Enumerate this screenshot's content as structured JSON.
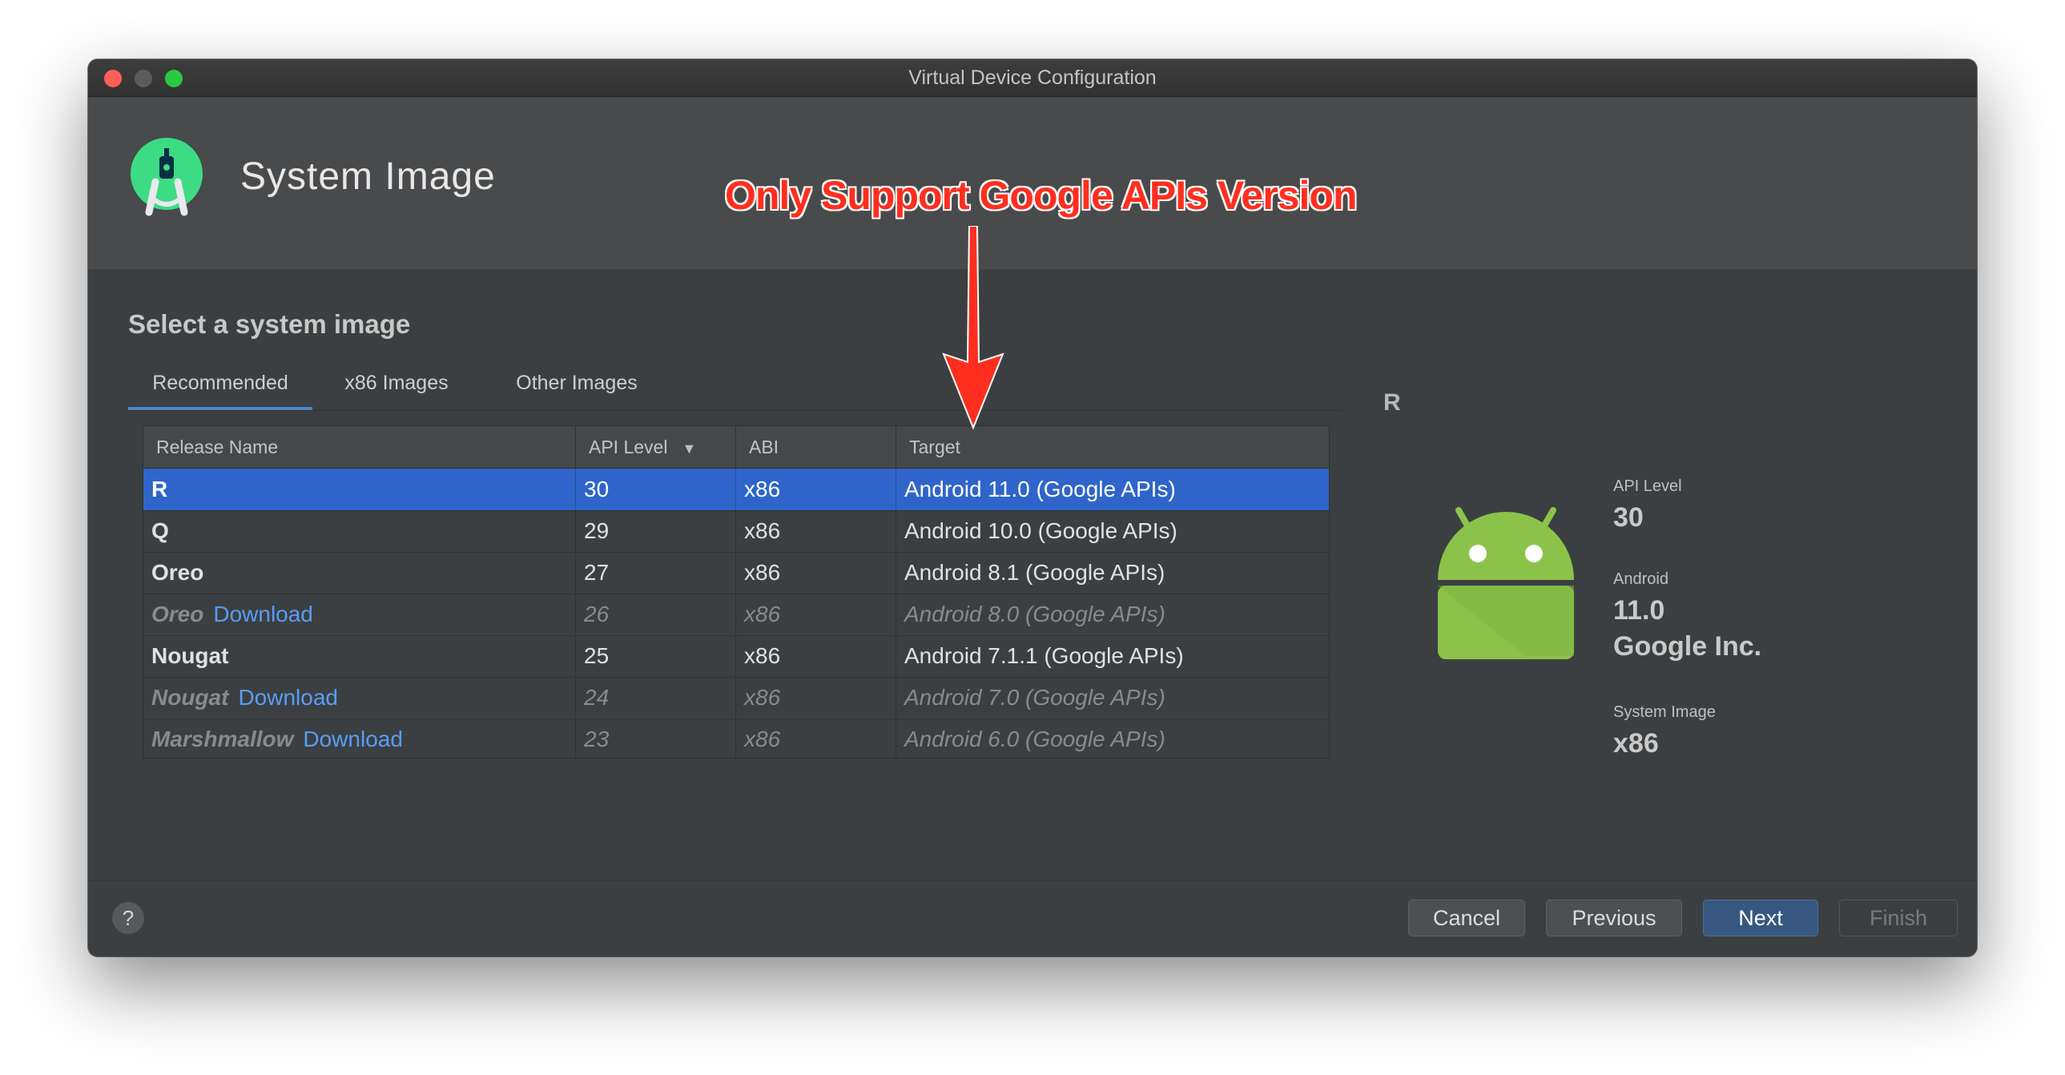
{
  "window": {
    "title": "Virtual Device Configuration"
  },
  "header": {
    "title": "System Image",
    "logo_icon": "android-studio-logo-icon"
  },
  "annotation": {
    "text": "Only Support Google APIs Version",
    "color": "#ff2e1f"
  },
  "section": {
    "title": "Select a system image"
  },
  "tabs": [
    {
      "label": "Recommended",
      "active": true
    },
    {
      "label": "x86 Images",
      "active": false
    },
    {
      "label": "Other Images",
      "active": false
    }
  ],
  "table": {
    "columns": [
      "Release Name",
      "API Level",
      "ABI",
      "Target"
    ],
    "sort_icon": "sort-desc-icon",
    "rows": [
      {
        "name": "R",
        "download": "",
        "api": "30",
        "abi": "x86",
        "target": "Android 11.0 (Google APIs)",
        "selected": true,
        "available": true
      },
      {
        "name": "Q",
        "download": "",
        "api": "29",
        "abi": "x86",
        "target": "Android 10.0 (Google APIs)",
        "selected": false,
        "available": true
      },
      {
        "name": "Oreo",
        "download": "",
        "api": "27",
        "abi": "x86",
        "target": "Android 8.1 (Google APIs)",
        "selected": false,
        "available": true
      },
      {
        "name": "Oreo",
        "download": "Download",
        "api": "26",
        "abi": "x86",
        "target": "Android 8.0 (Google APIs)",
        "selected": false,
        "available": false
      },
      {
        "name": "Nougat",
        "download": "",
        "api": "25",
        "abi": "x86",
        "target": "Android 7.1.1 (Google APIs)",
        "selected": false,
        "available": true
      },
      {
        "name": "Nougat",
        "download": "Download",
        "api": "24",
        "abi": "x86",
        "target": "Android 7.0 (Google APIs)",
        "selected": false,
        "available": false
      },
      {
        "name": "Marshmallow",
        "download": "Download",
        "api": "23",
        "abi": "x86",
        "target": "Android 6.0 (Google APIs)",
        "selected": false,
        "available": false
      }
    ]
  },
  "details": {
    "release": "R",
    "icon": "android-robot-icon",
    "api_label": "API Level",
    "api_value": "30",
    "android_label": "Android",
    "android_version": "11.0",
    "vendor": "Google Inc.",
    "system_image_label": "System Image",
    "system_image_value": "x86"
  },
  "footer": {
    "help": "?",
    "cancel": "Cancel",
    "previous": "Previous",
    "next": "Next",
    "finish": "Finish"
  },
  "colors": {
    "accent": "#2f65ca",
    "link": "#589df6",
    "background": "#3c3f41"
  }
}
